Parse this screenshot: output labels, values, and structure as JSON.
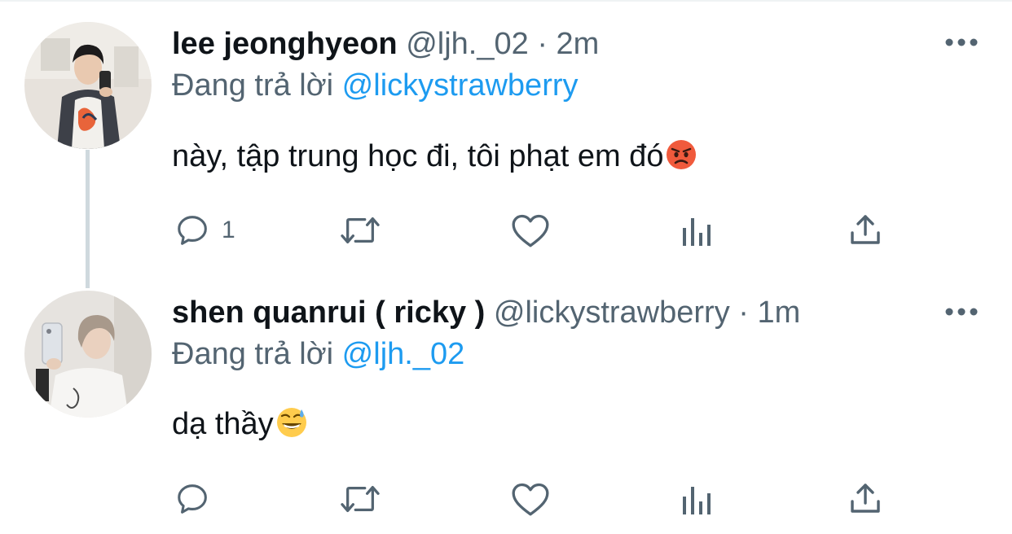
{
  "colors": {
    "accent": "#1d9bf0",
    "secondary": "#536471",
    "text": "#0f1419",
    "thread_line": "#cfd9de"
  },
  "tweets": [
    {
      "author_name": "lee jeonghyeon",
      "handle": "@ljh._02",
      "separator": "·",
      "time": "2m",
      "reply_prefix": "Đang trả lời",
      "reply_to": "@lickystrawberry",
      "text": "này, tập trung học đi, tôi phạt em đó",
      "emoji": "pouting-face-emoji",
      "reply_count": "1"
    },
    {
      "author_name": "shen quanrui ( ricky )",
      "handle": "@lickystrawberry",
      "separator": "·",
      "time": "1m",
      "reply_prefix": "Đang trả lời",
      "reply_to": "@ljh._02",
      "text": "dạ thầy",
      "emoji": "grinning-sweat-emoji",
      "reply_count": ""
    }
  ],
  "icons": [
    "reply-icon",
    "retweet-icon",
    "like-icon",
    "analytics-icon",
    "share-icon",
    "more-icon"
  ]
}
